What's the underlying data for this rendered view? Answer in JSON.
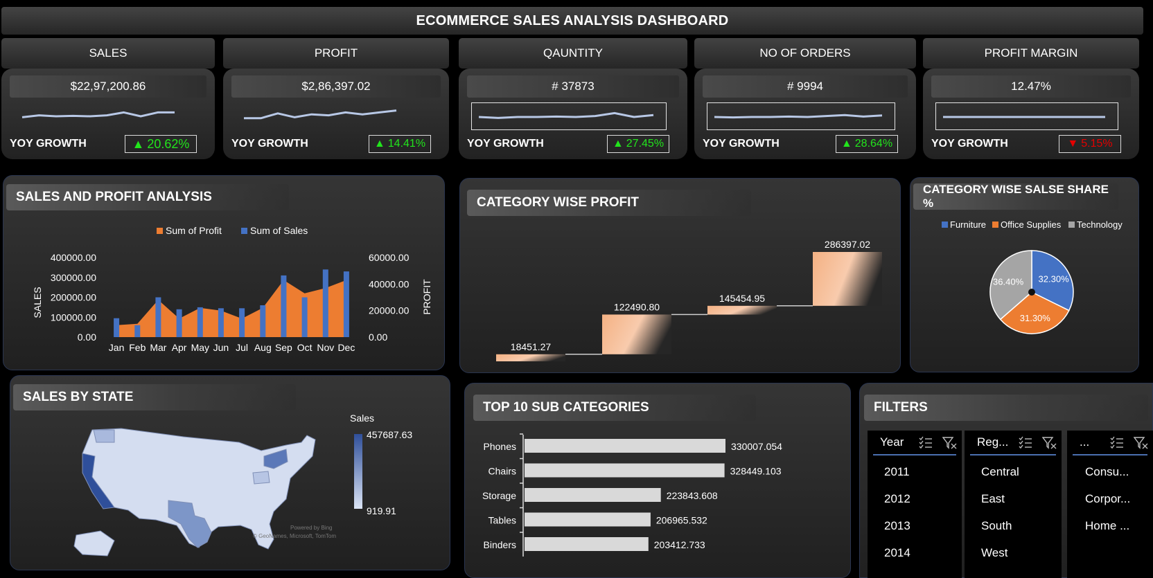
{
  "dashboard": {
    "title": "ECOMMERCE SALES ANALYSIS DASHBOARD"
  },
  "kpis": [
    {
      "label": "SALES",
      "value": "$22,97,200.86",
      "yoy_label": "YOY GROWTH",
      "yoy": "20.62%",
      "direction": "up",
      "trend": [
        0.55,
        0.45,
        0.5,
        0.48,
        0.5,
        0.45,
        0.3,
        0.5,
        0.3,
        0.3
      ]
    },
    {
      "label": "PROFIT",
      "value": "$2,86,397.02",
      "yoy_label": "YOY GROWTH",
      "yoy": "14.41%",
      "direction": "up",
      "trend": [
        0.6,
        0.6,
        0.35,
        0.55,
        0.4,
        0.45,
        0.3,
        0.4,
        0.3,
        0.2
      ]
    },
    {
      "label": "QAUNTITY",
      "value": "# 37873",
      "yoy_label": "YOY GROWTH",
      "yoy": "27.45%",
      "direction": "up",
      "trend": [
        0.5,
        0.55,
        0.5,
        0.5,
        0.48,
        0.5,
        0.45,
        0.3,
        0.5,
        0.4
      ]
    },
    {
      "label": "NO OF ORDERS",
      "value": "# 9994",
      "yoy_label": "YOY GROWTH",
      "yoy": "28.64%",
      "direction": "up",
      "trend": [
        0.5,
        0.52,
        0.5,
        0.5,
        0.48,
        0.5,
        0.45,
        0.4,
        0.48,
        0.42
      ]
    },
    {
      "label": "PROFIT MARGIN",
      "value": "12.47%",
      "yoy_label": "YOY GROWTH",
      "yoy": "5.15%",
      "direction": "down",
      "trend": [
        0.5,
        0.5,
        0.5,
        0.5,
        0.5,
        0.5,
        0.5,
        0.5,
        0.5,
        0.5
      ]
    }
  ],
  "panels": {
    "sales_profit": "SALES AND PROFIT ANALYSIS",
    "category_profit": "CATEGORY WISE PROFIT",
    "category_share": "CATEGORY WISE SALSE SHARE %",
    "sales_by_state": "SALES BY STATE",
    "top10": "TOP 10 SUB CATEGORIES",
    "filters": "FILTERS"
  },
  "chart_data": [
    {
      "type": "bar",
      "title": "SALES AND PROFIT ANALYSIS",
      "categories": [
        "Jan",
        "Feb",
        "Mar",
        "Apr",
        "May",
        "Jun",
        "Jul",
        "Aug",
        "Sep",
        "Oct",
        "Nov",
        "Dec"
      ],
      "series": [
        {
          "name": "Sum of Profit",
          "axis": "right",
          "chart": "area",
          "color": "#ed7d31",
          "values": [
            9000,
            10000,
            28000,
            14000,
            22000,
            20000,
            14000,
            22000,
            43000,
            33000,
            37000,
            43000
          ]
        },
        {
          "name": "Sum of Sales",
          "axis": "left",
          "chart": "bar",
          "color": "#4472c4",
          "values": [
            95000,
            60000,
            200000,
            140000,
            150000,
            145000,
            145000,
            160000,
            310000,
            200000,
            340000,
            330000
          ]
        }
      ],
      "ylabel": "SALES",
      "y2label": "PROFIT",
      "ylim": [
        0,
        400000
      ],
      "y2lim": [
        0,
        60000
      ],
      "yticks": [
        "400000.00",
        "300000.00",
        "200000.00",
        "100000.00",
        "0.00"
      ],
      "y2ticks": [
        "60000.00",
        "40000.00",
        "20000.00",
        "0.00"
      ],
      "legend": "top"
    },
    {
      "type": "bar",
      "subtype": "waterfall",
      "title": "CATEGORY WISE PROFIT",
      "values": [
        18451.27,
        122490.8,
        145454.95,
        286397.02
      ],
      "labels": [
        "18451.27",
        "122490.80",
        "145454.95",
        "286397.02"
      ],
      "ylim": [
        0,
        286397.02
      ]
    },
    {
      "type": "pie",
      "title": "CATEGORY WISE SALSE SHARE %",
      "categories": [
        "Furniture",
        "Office Supplies",
        "Technology"
      ],
      "values": [
        32.3,
        31.3,
        36.4
      ],
      "labels": [
        "32.30%",
        "31.30%",
        "36.40%"
      ],
      "colors": [
        "#4472c4",
        "#ed7d31",
        "#a5a5a5"
      ],
      "legend": "top"
    },
    {
      "type": "bar",
      "orientation": "horizontal",
      "title": "TOP 10 SUB CATEGORIES",
      "categories": [
        "Phones",
        "Chairs",
        "Storage",
        "Tables",
        "Binders"
      ],
      "values": [
        330007.054,
        328449.103,
        223843.608,
        206965.532,
        203412.733
      ],
      "labels": [
        "330007.054",
        "328449.103",
        "223843.608",
        "206965.532",
        "203412.733"
      ]
    }
  ],
  "map": {
    "legend_title": "Sales",
    "max_label": "457687.63",
    "min_label": "919.91",
    "credit_1": "Powered by Bing",
    "credit_2": "© GeoNames, Microsoft, TomTom"
  },
  "filters": {
    "slicers": [
      {
        "header": "Year",
        "items": [
          "2011",
          "2012",
          "2013",
          "2014"
        ]
      },
      {
        "header": "Reg...",
        "items": [
          "Central",
          "East",
          "South",
          "West"
        ]
      },
      {
        "header": "...",
        "items": [
          "Consu...",
          "Corpor...",
          "Home ..."
        ]
      }
    ]
  }
}
